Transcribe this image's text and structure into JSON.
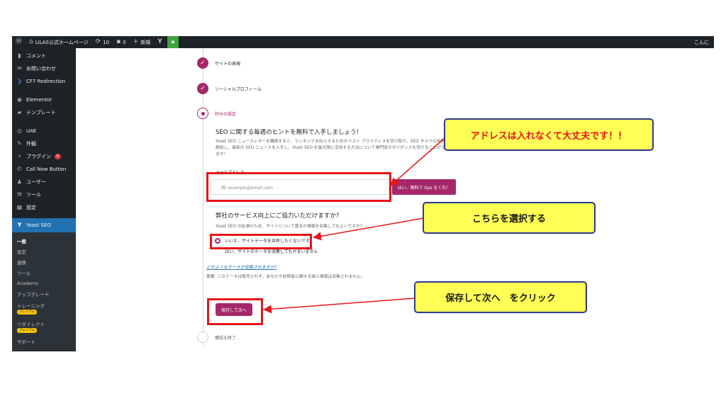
{
  "admin_bar": {
    "site_name": "LILAS公式ホームページ",
    "updates_count": "10",
    "comments_count": "0",
    "new_label": "新規",
    "right_text": "こんに"
  },
  "sidebar": {
    "items": [
      {
        "label": "コメント",
        "icon": "comment-icon"
      },
      {
        "label": "お問い合わせ",
        "icon": "mail-icon"
      },
      {
        "label": "CF7 Redirection",
        "icon": "redirect-icon"
      },
      {
        "label": "Elementor",
        "icon": "elementor-icon"
      },
      {
        "label": "テンプレート",
        "icon": "folder-icon"
      },
      {
        "label": "UAE",
        "icon": "uae-icon"
      },
      {
        "label": "外観",
        "icon": "brush-icon"
      },
      {
        "label": "プラグイン",
        "icon": "plugin-icon",
        "badge": "6"
      },
      {
        "label": "Call Now Button",
        "icon": "phone-icon"
      },
      {
        "label": "ユーザー",
        "icon": "user-icon"
      },
      {
        "label": "ツール",
        "icon": "wrench-icon"
      },
      {
        "label": "設定",
        "icon": "settings-icon"
      },
      {
        "label": "Yoast SEO",
        "icon": "yoast-icon",
        "active": true
      }
    ],
    "submenu": {
      "general": "一般",
      "settings": "設定",
      "integrations": "連携",
      "tools": "ツール",
      "academy": "Academy",
      "upgrade": "アップグレード",
      "training": "トレーニング",
      "redirects": "リダイレクト",
      "support": "サポート",
      "premium_badge": "プレミアム"
    }
  },
  "wizard": {
    "steps": {
      "site_representation": "サイトの表現",
      "social_profiles": "ソーシャルプロフィール",
      "preferences": "好みの設定",
      "finish": "構成を終了"
    },
    "newsletter": {
      "heading": "SEO に関する毎週のヒントを無料で入手しましょう!",
      "description": "Yoast SEO ニュースレターを購読すると、ランキングを向上するためのベスト プラクティスを受け取り、SEO タスクの時間を節約し、最新の SEO ニュースを入手し、Yoast SEO を最大限に活用する方法について専門家のガイダンスを受けることができます！",
      "email_label": "メールアドレス",
      "email_placeholder": "例: example@email.com",
      "submit_label": "はい、無料で tips をくれ！"
    },
    "tracking": {
      "heading": "弊社のサービス向上にご協力いただけますか?",
      "description": "Yoast SEO の拡張のため、サイトについて匿名の情報を収集してもよいですか？",
      "option_no": "いいえ、サイトデータを共有したくないです",
      "option_yes": "はい、サイトのデータを収集してもかまいません",
      "link": "どのようなデータが収集されますか?",
      "note": "重要: このデータは販売されず、あなたや訪問者に関する個人情報は収集されません。"
    },
    "save_button": "保存して次へ"
  },
  "callouts": {
    "email_note": "アドレスは入れなくて大丈夫です！！",
    "select_note": "こちらを選択する",
    "save_note": "保存して次へ　をクリック"
  },
  "colors": {
    "yoast_accent": "#a4286a",
    "admin_dark": "#1d2327",
    "wp_blue": "#2271b1",
    "highlight_red": "#e8141a",
    "callout_yellow": "#ffff55",
    "callout_border": "#2e3a8c",
    "callout_text_red": "#e8141a",
    "callout_text_dark": "#1a1a1a"
  }
}
